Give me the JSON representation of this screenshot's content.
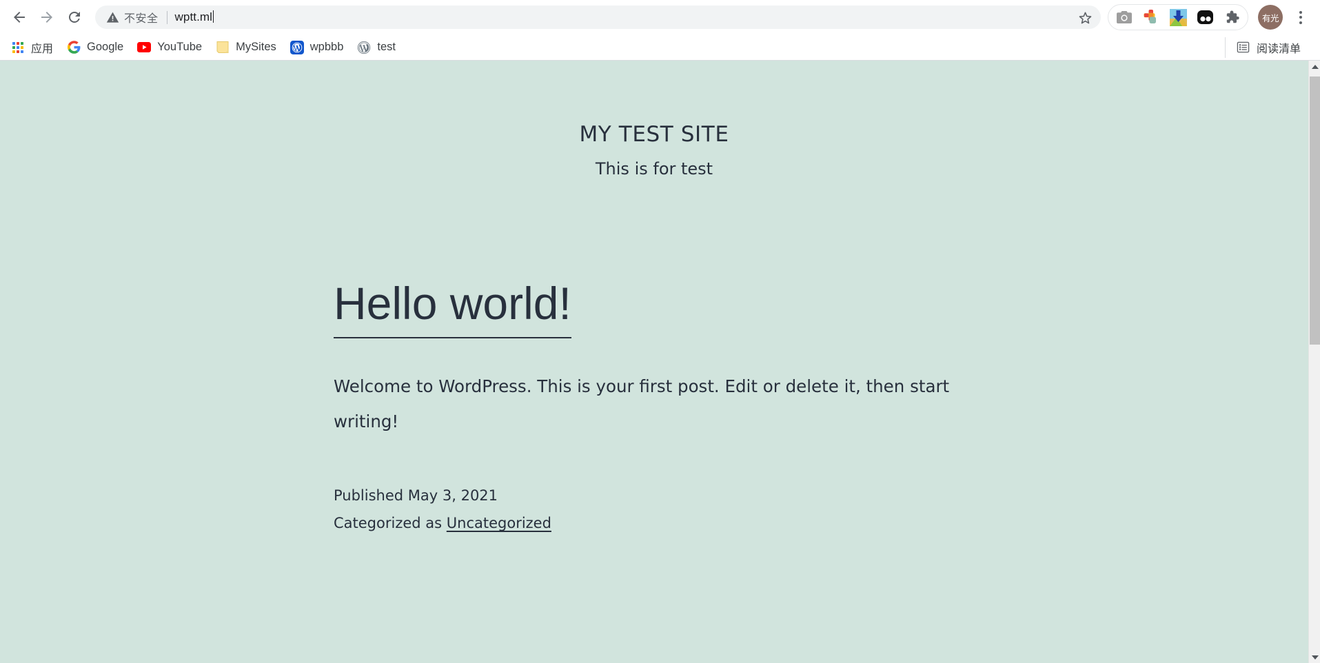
{
  "browser": {
    "nav": {
      "back_icon": "arrow-left-icon",
      "forward_icon": "arrow-right-icon",
      "reload_icon": "reload-icon"
    },
    "omnibox": {
      "security_icon": "warning-triangle-icon",
      "security_label": "不安全",
      "url": "wptt.ml",
      "star_icon": "star-outline-icon"
    },
    "extensions": [
      {
        "name": "camera-icon",
        "title": "Screenshot"
      },
      {
        "name": "colorful-plus-icon",
        "title": "Extension"
      },
      {
        "name": "download-arrow-icon",
        "title": "IDM Integration"
      },
      {
        "name": "two-dots-icon",
        "title": "Extension"
      },
      {
        "name": "puzzle-piece-icon",
        "title": "Extensions"
      }
    ],
    "avatar_label": "有光",
    "menu_icon": "three-dot-menu-icon",
    "bookmarks": [
      {
        "label": "应用",
        "icon": "apps-grid-icon",
        "cjk": true
      },
      {
        "label": "Google",
        "icon": "google-icon",
        "cjk": false
      },
      {
        "label": "YouTube",
        "icon": "youtube-icon",
        "cjk": false
      },
      {
        "label": "MySites",
        "icon": "folder-icon",
        "cjk": false
      },
      {
        "label": "wpbbb",
        "icon": "wordpress-blue-icon",
        "cjk": false
      },
      {
        "label": "test",
        "icon": "wordpress-gray-icon",
        "cjk": false
      }
    ],
    "reading_list": {
      "label": "阅读清单",
      "icon": "reading-list-icon"
    }
  },
  "site": {
    "title": "MY TEST SITE",
    "tagline": "This is for test",
    "background_color": "#d1e4dd",
    "text_color": "#28303d"
  },
  "post": {
    "title": "Hello world!",
    "excerpt": "Welcome to WordPress. This is your first post. Edit or delete it, then start writing!",
    "published_label": "Published May 3, 2021",
    "categorized_prefix": "Categorized as ",
    "category": "Uncategorized"
  },
  "scrollbar": {
    "up_icon": "scroll-up-arrow-icon",
    "down_icon": "scroll-down-arrow-icon"
  }
}
